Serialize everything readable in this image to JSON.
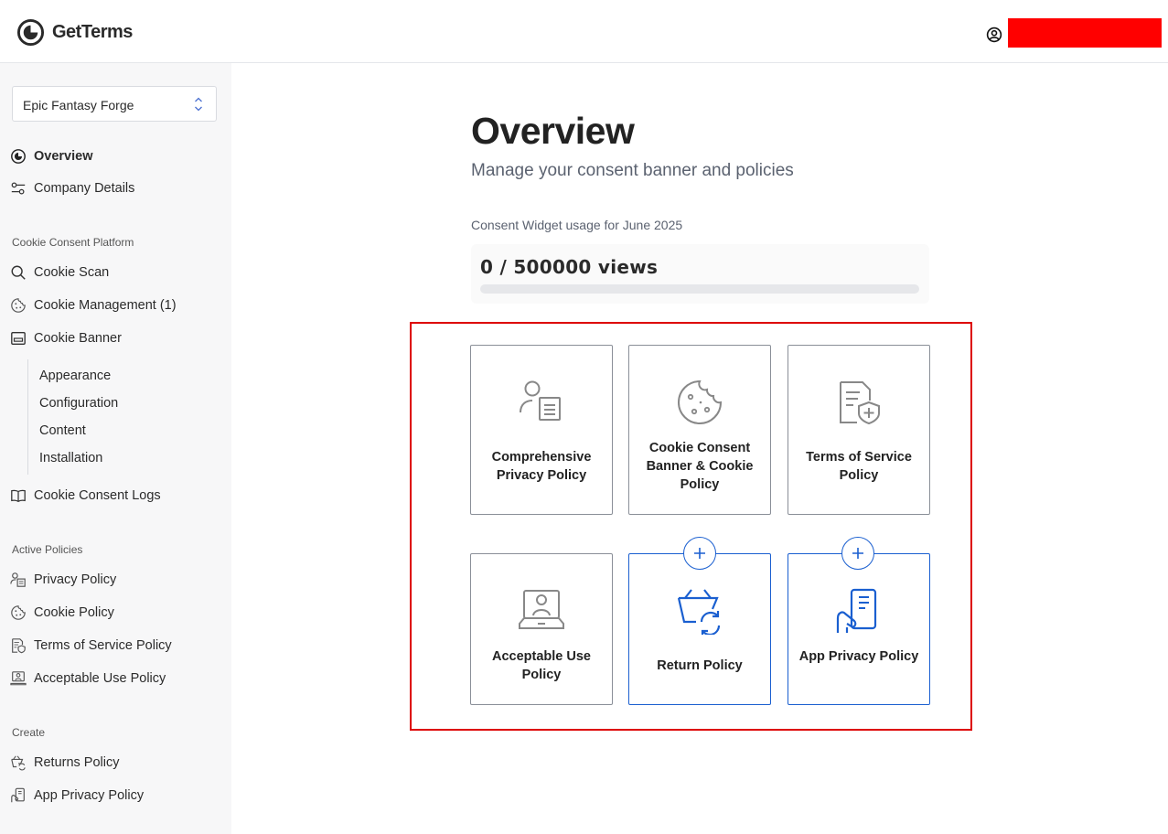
{
  "brand": {
    "name": "GetTerms"
  },
  "site_selector": {
    "value": "Epic Fantasy Forge"
  },
  "nav": {
    "overview": "Overview",
    "company_details": "Company Details",
    "cookie_section": "Cookie Consent Platform",
    "cookie_scan": "Cookie Scan",
    "cookie_management": "Cookie Management (1)",
    "cookie_banner": "Cookie Banner",
    "banner_sub": [
      "Appearance",
      "Configuration",
      "Content",
      "Installation"
    ],
    "cookie_consent_logs": "Cookie Consent Logs",
    "active_section": "Active Policies",
    "active": [
      "Privacy Policy",
      "Cookie Policy",
      "Terms of Service Policy",
      "Acceptable Use Policy"
    ],
    "create_section": "Create",
    "create": [
      "Returns Policy",
      "App Privacy Policy"
    ]
  },
  "main": {
    "title": "Overview",
    "subtitle": "Manage your consent banner and policies",
    "usage_label": "Consent Widget usage for June 2025",
    "usage_value": "0 / 500000 views",
    "usage_fraction": 0
  },
  "cards": {
    "privacy": "Comprehensive Privacy Policy",
    "cookie": "Cookie Consent Banner & Cookie Policy",
    "tos": "Terms of Service Policy",
    "aup": "Acceptable Use Policy",
    "returns": "Return Policy",
    "app_privacy": "App Privacy Policy"
  },
  "colors": {
    "accent": "#1a5fd0",
    "highlight": "#dd0000",
    "redacted": "#ff0000"
  }
}
